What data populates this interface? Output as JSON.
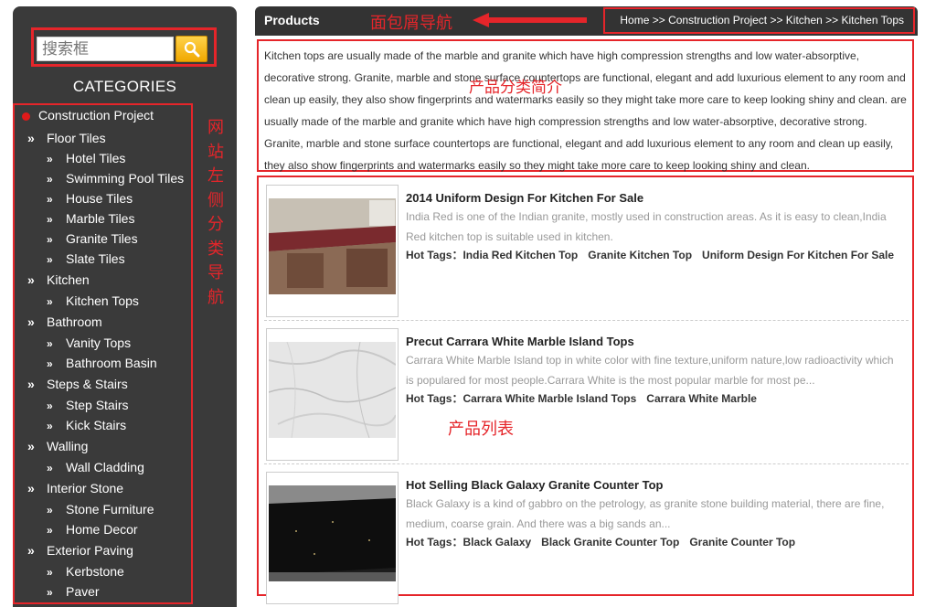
{
  "colors": {
    "sidebar_bg": "#3a3a3a",
    "highlight": "#e5252a",
    "search_button": "#f5b400"
  },
  "search": {
    "placeholder": "搜索框",
    "button_icon": "magnifier-icon"
  },
  "sidebar": {
    "title": "CATEGORIES",
    "annotation": [
      "网",
      "站",
      "左",
      "侧",
      "分",
      "类",
      "导",
      "航"
    ],
    "items": [
      {
        "label": "Construction Project",
        "level": 0
      },
      {
        "label": "Floor Tiles",
        "level": 1
      },
      {
        "label": "Hotel Tiles",
        "level": 2
      },
      {
        "label": "Swimming Pool Tiles",
        "level": 2
      },
      {
        "label": "House Tiles",
        "level": 2
      },
      {
        "label": "Marble Tiles",
        "level": 2
      },
      {
        "label": "Granite Tiles",
        "level": 2
      },
      {
        "label": "Slate Tiles",
        "level": 2
      },
      {
        "label": "Kitchen",
        "level": 1
      },
      {
        "label": "Kitchen Tops",
        "level": 2
      },
      {
        "label": "Bathroom",
        "level": 1
      },
      {
        "label": "Vanity Tops",
        "level": 2
      },
      {
        "label": "Bathroom Basin",
        "level": 2
      },
      {
        "label": "Steps & Stairs",
        "level": 1
      },
      {
        "label": "Step Stairs",
        "level": 2
      },
      {
        "label": "Kick Stairs",
        "level": 2
      },
      {
        "label": "Walling",
        "level": 1
      },
      {
        "label": "Wall Cladding",
        "level": 2
      },
      {
        "label": "Interior Stone",
        "level": 1
      },
      {
        "label": "Stone Furniture",
        "level": 2
      },
      {
        "label": "Home Decor",
        "level": 2
      },
      {
        "label": "Exterior Paving",
        "level": 1
      },
      {
        "label": "Kerbstone",
        "level": 2
      },
      {
        "label": "Paver",
        "level": 2
      }
    ]
  },
  "header": {
    "title": "Products",
    "breadcrumb_annotation": "面包屑导航",
    "breadcrumb": "Home >> Construction Project  >> Kitchen  >> Kitchen Tops"
  },
  "description": {
    "annotation": "产品分类简介",
    "text": "Kitchen tops are usually made of the marble and granite which have high compression strengths and low water-absorptive, decorative strong. Granite, marble and stone surface countertops are functional, elegant and add luxurious element to any room and clean up easily, they also show fingerprints and watermarks easily so they might take more care to keep looking shiny and clean. are usually made of the marble and granite which have high compression strengths and low water-absorptive, decorative strong. Granite, marble and stone surface countertops are functional, elegant and add luxurious element to any room and clean up easily, they also show fingerprints and watermarks easily so they might take more care to keep looking shiny and clean."
  },
  "products": {
    "annotation": "产品列表",
    "tags_label": "Hot Tags：",
    "items": [
      {
        "title": "2014 Uniform Design For Kitchen For Sale",
        "desc": "India Red is one of the Indian granite, mostly used in construction areas. As it is easy to clean,India Red kitchen top is suitable used in kitchen.",
        "tags": [
          "India Red Kitchen Top",
          "Granite Kitchen Top",
          "Uniform Design For Kitchen For Sale"
        ]
      },
      {
        "title": "Precut Carrara White Marble Island Tops",
        "desc": "Carrara White Marble Island top in white color with fine texture,uniform nature,low radioactivity which is populared for most people.Carrara White is the most popular marble for most pe...",
        "tags": [
          "Carrara White Marble Island Tops",
          "Carrara White Marble"
        ]
      },
      {
        "title": "Hot Selling Black Galaxy Granite Counter Top",
        "desc": "Black Galaxy is a kind of gabbro on the petrology, as granite stone building material, there are fine, medium, coarse grain. And there was a big sands an...",
        "tags": [
          "Black Galaxy",
          "Black Granite Counter Top",
          "Granite Counter Top"
        ]
      }
    ]
  }
}
